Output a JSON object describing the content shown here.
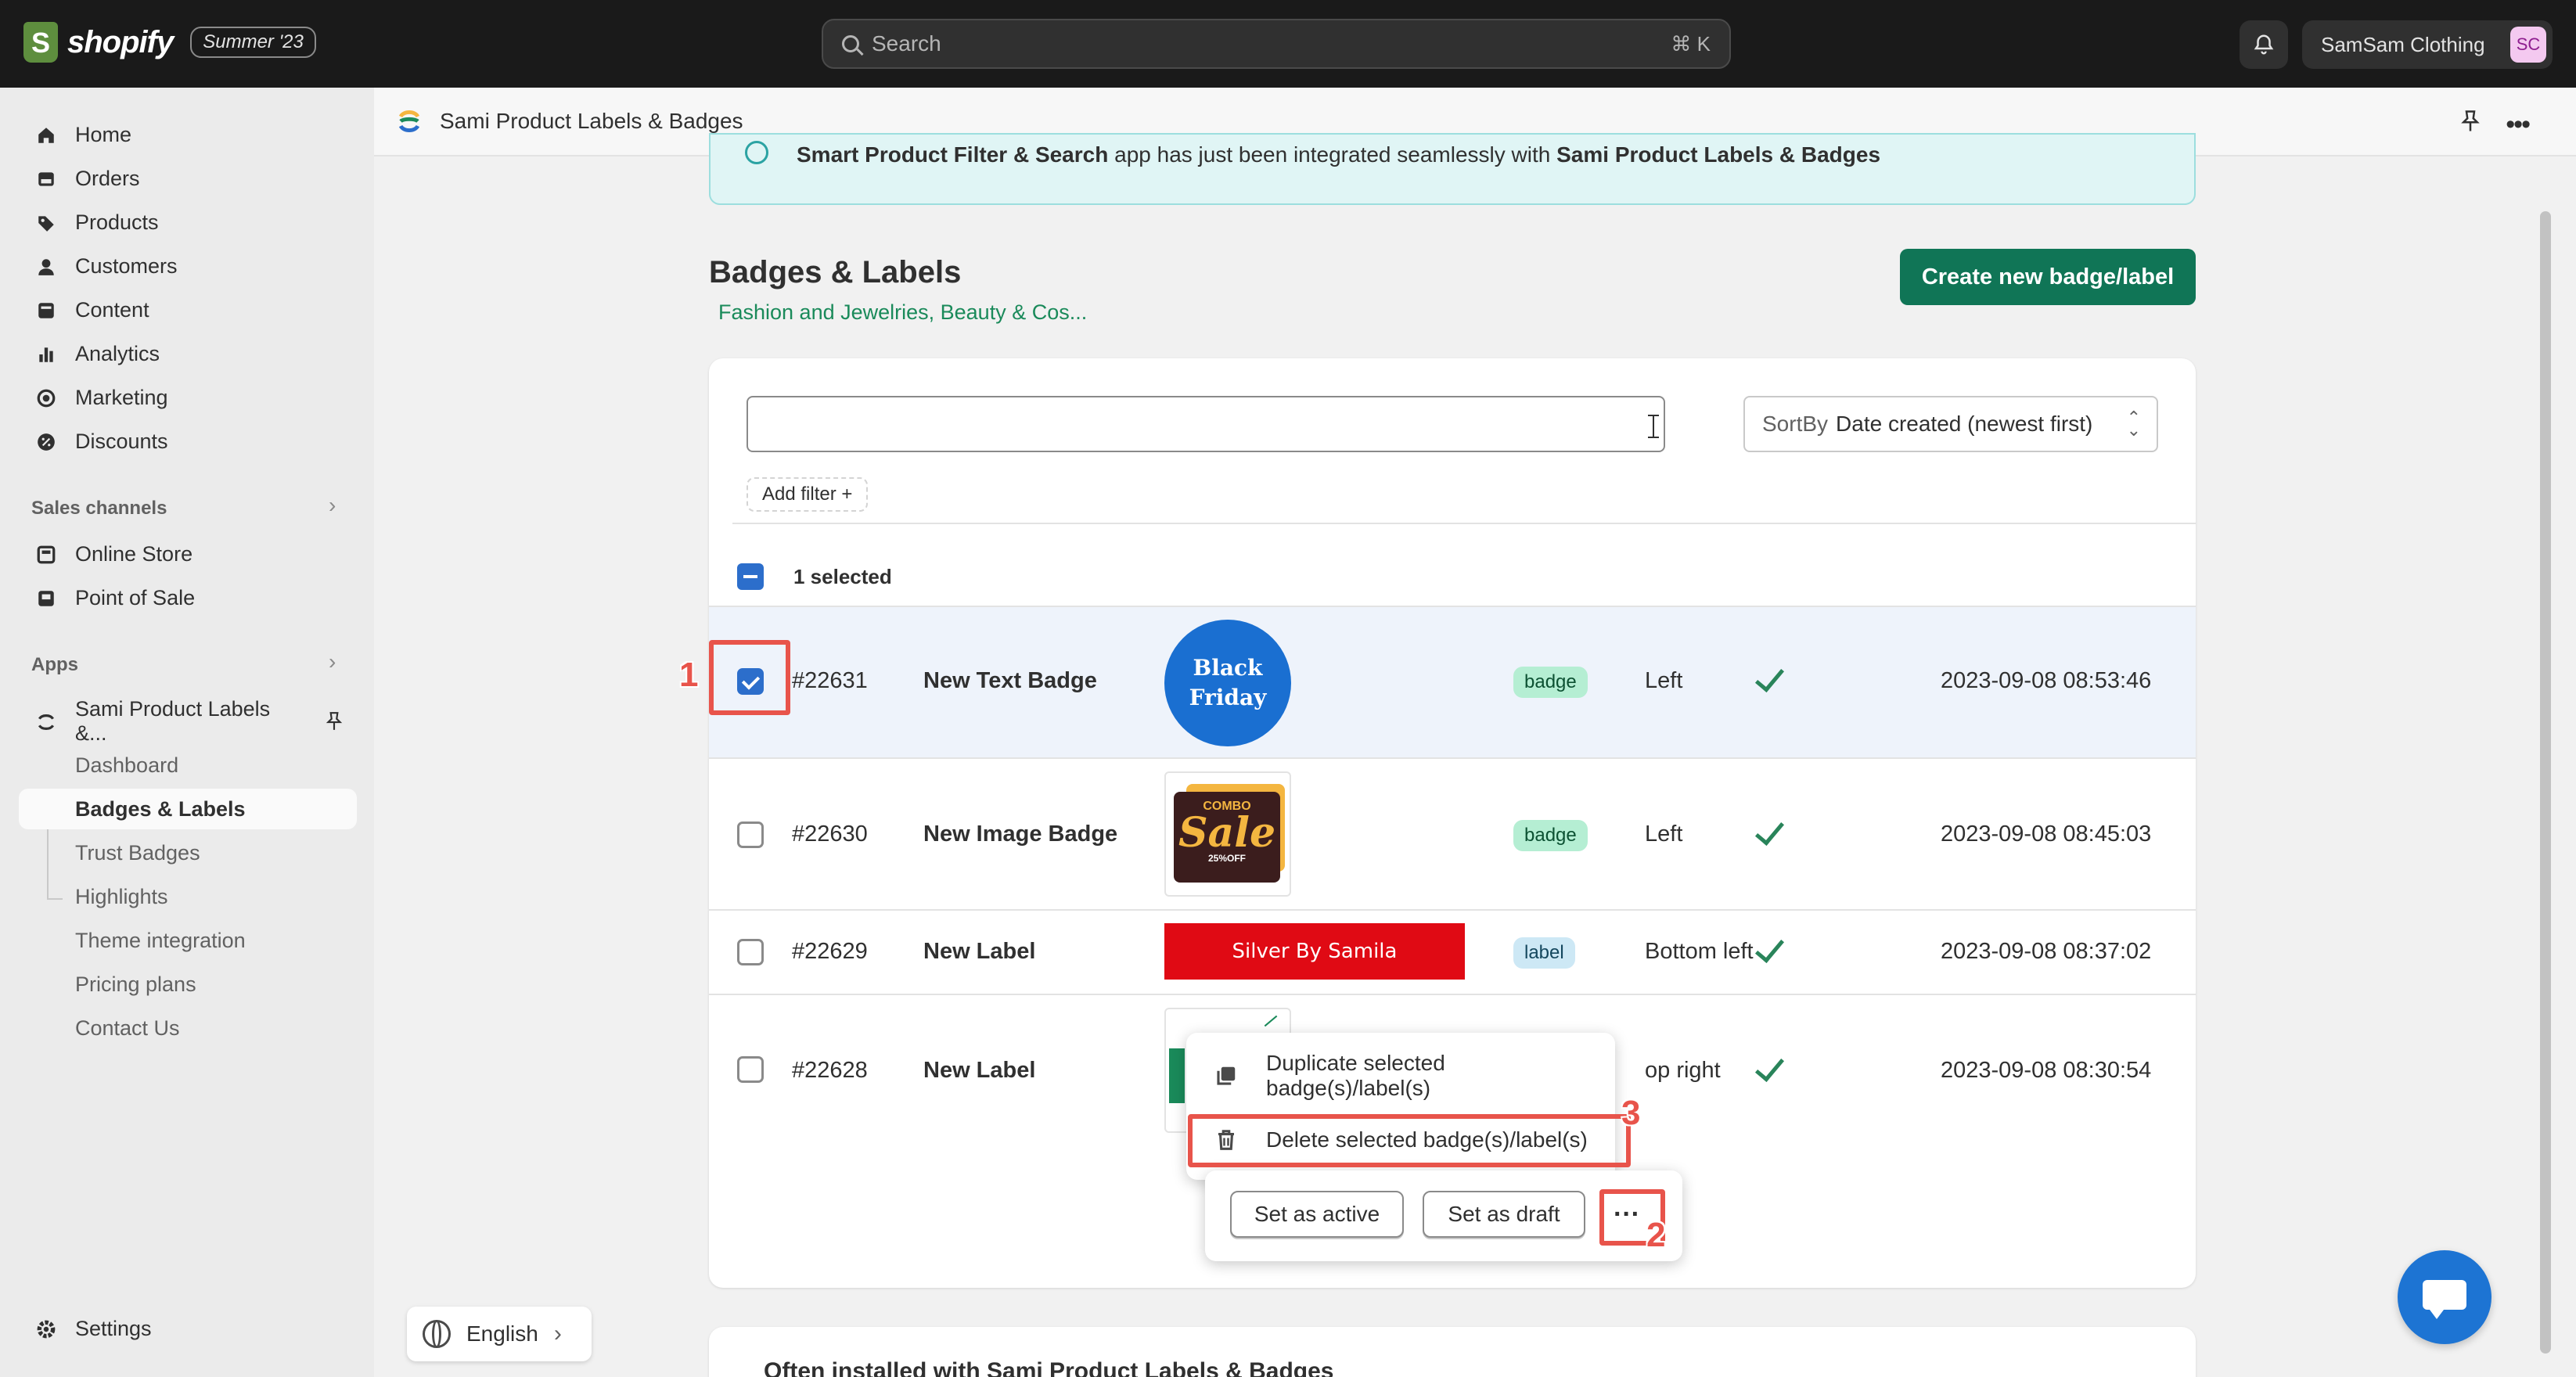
{
  "topbar": {
    "brand": "shopify",
    "edition": "Summer '23",
    "search_placeholder": "Search",
    "search_shortcut": "⌘ K",
    "store_name": "SamSam Clothing",
    "avatar_initials": "SC"
  },
  "sidebar": {
    "main_items": [
      {
        "label": "Home",
        "icon": "home-icon"
      },
      {
        "label": "Orders",
        "icon": "orders-icon"
      },
      {
        "label": "Products",
        "icon": "tag-icon"
      },
      {
        "label": "Customers",
        "icon": "person-icon"
      },
      {
        "label": "Content",
        "icon": "content-icon"
      },
      {
        "label": "Analytics",
        "icon": "bar-chart-icon"
      },
      {
        "label": "Marketing",
        "icon": "target-icon"
      },
      {
        "label": "Discounts",
        "icon": "discount-icon"
      }
    ],
    "sales_channels_title": "Sales channels",
    "sales_channels": [
      {
        "label": "Online Store",
        "icon": "store-icon"
      },
      {
        "label": "Point of Sale",
        "icon": "pos-icon"
      }
    ],
    "apps_title": "Apps",
    "app_name": "Sami Product Labels &...",
    "app_sub_items": [
      "Dashboard",
      "Badges & Labels",
      "Trust Badges",
      "Highlights",
      "Theme integration",
      "Pricing plans",
      "Contact Us"
    ],
    "active_sub_item": "Badges & Labels",
    "settings": "Settings",
    "language": "English"
  },
  "app_header": {
    "title": "Sami Product Labels & Badges"
  },
  "banner": {
    "bold1": "Smart Product Filter & Search",
    "text": " app has just been integrated seamlessly with ",
    "bold2": "Sami Product Labels & Badges"
  },
  "page": {
    "title": "Badges & Labels",
    "subtitle": "Fashion and Jewelries, Beauty & Cos...",
    "create_button": "Create new badge/label"
  },
  "list": {
    "search_value": "",
    "sort_label": "SortBy",
    "sort_value": "Date created (newest first)",
    "add_filter": "Add filter +",
    "selected_text": "1 selected",
    "rows": [
      {
        "id": "#22631",
        "name": "New Text Badge",
        "preview": "Black Friday",
        "preview_line1": "Black",
        "preview_line2": "Friday",
        "type": "badge",
        "position": "Left",
        "active": true,
        "created": "2023-09-08 08:53:46",
        "checked": true
      },
      {
        "id": "#22630",
        "name": "New Image Badge",
        "preview": "COMBO Sale 25%OFF",
        "preview_line1": "COMBO",
        "preview_line2": "Sale",
        "preview_line3": "25%OFF",
        "type": "badge",
        "position": "Left",
        "active": true,
        "created": "2023-09-08 08:45:03",
        "checked": false
      },
      {
        "id": "#22629",
        "name": "New Label",
        "preview": "Silver By Samila",
        "type": "label",
        "position": "Bottom left",
        "active": true,
        "created": "2023-09-08 08:37:02",
        "checked": false
      },
      {
        "id": "#22628",
        "name": "New Label",
        "preview": "",
        "type": "",
        "position": "op right",
        "active": true,
        "created": "2023-09-08 08:30:54",
        "checked": false
      }
    ]
  },
  "popup_menu": {
    "duplicate": "Duplicate selected badge(s)/label(s)",
    "delete": "Delete selected badge(s)/label(s)"
  },
  "bulk_actions": {
    "set_active": "Set as active",
    "set_draft": "Set as draft",
    "more": "···"
  },
  "annotations": [
    "1",
    "2",
    "3"
  ],
  "below_card_title": "Often installed with Sami Product Labels & Badges",
  "colors": {
    "primary_green": "#107556",
    "selection_blue": "#2c6ecb",
    "annotation_red": "#e8544b"
  }
}
